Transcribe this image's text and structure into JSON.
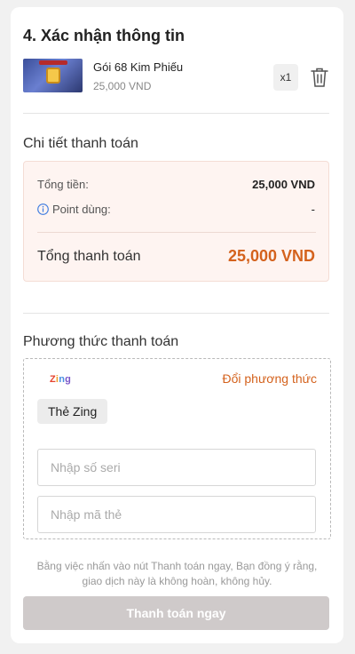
{
  "section_title": "4. Xác nhận thông tin",
  "product": {
    "name": "Gói 68 Kim Phiếu",
    "price": "25,000 VND",
    "quantity": "x1",
    "thumbnail_icon": "game-item-thumbnail",
    "delete_icon": "trash-icon"
  },
  "payment_details": {
    "title": "Chi tiết thanh toán",
    "total_label": "Tổng tiền:",
    "total_value": "25,000 VND",
    "points_label": "Point dùng:",
    "points_value": "-",
    "grand_total_label": "Tổng thanh toán",
    "grand_total_value": "25,000 VND"
  },
  "payment_method": {
    "title": "Phương thức thanh toán",
    "provider_logo": "Zing",
    "change_label": "Đổi phương thức",
    "selected_card": "Thẻ Zing",
    "serial_placeholder": "Nhập số seri",
    "code_placeholder": "Nhập mã thẻ"
  },
  "disclaimer": "Bằng việc nhấn vào nút Thanh toán ngay, Bạn đồng ý rằng, giao dịch này là không hoàn, không hủy.",
  "pay_button": "Thanh toán ngay",
  "colors": {
    "accent": "#d4621d",
    "summary_bg": "#fef4f1",
    "button_disabled": "#cfcaca"
  }
}
